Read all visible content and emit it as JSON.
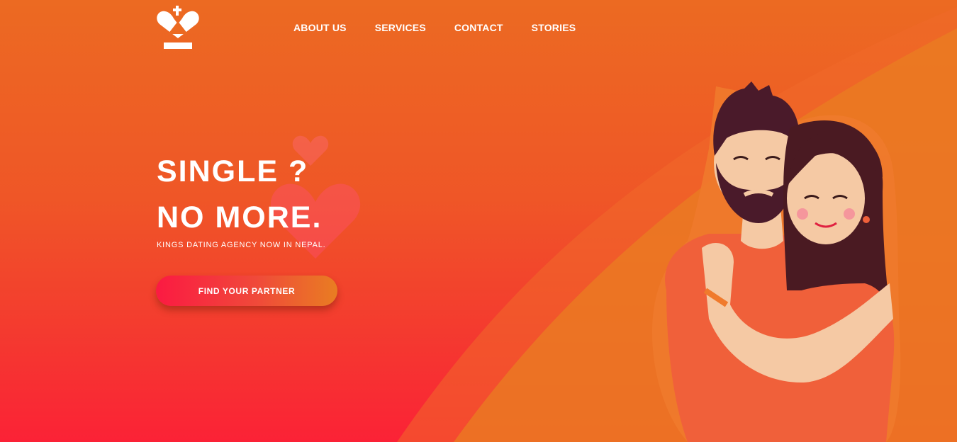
{
  "nav": {
    "items": [
      {
        "label": "ABOUT US"
      },
      {
        "label": "SERVICES"
      },
      {
        "label": "CONTACT"
      },
      {
        "label": "STORIES"
      }
    ]
  },
  "hero": {
    "title_line1": "SINGLE ?",
    "title_line2": "NO MORE.",
    "subtitle": "KINGS DATING AGENCY NOW IN NEPAL.",
    "cta_label": "FIND YOUR PARTNER"
  },
  "icons": {
    "logo": "crown-heart-logo",
    "decor": "heart-icon"
  },
  "colors": {
    "background_top": "#ec6a22",
    "background_bottom": "#fb2236",
    "cta_start": "#fb1a42",
    "cta_end": "#e97d22",
    "text": "#ffffff"
  }
}
